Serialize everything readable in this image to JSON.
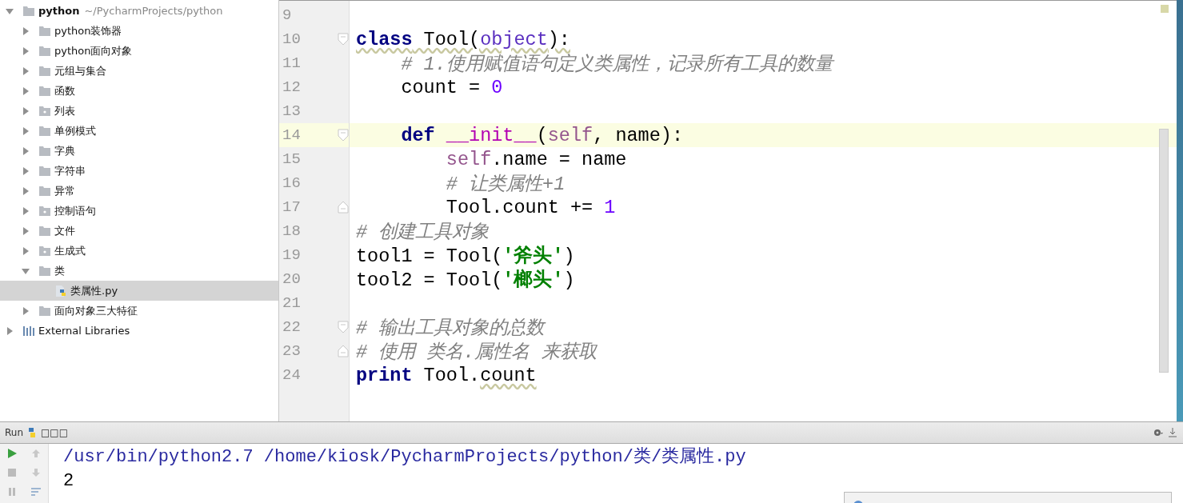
{
  "project_tree": [
    {
      "label": "python",
      "path": "~/PycharmProjects/python",
      "kind": "folder",
      "expanded": true,
      "selected": false,
      "children": [
        {
          "label": "python装饰器",
          "kind": "folder",
          "expanded": false,
          "selected": false
        },
        {
          "label": "python面向对象",
          "kind": "folder",
          "expanded": false,
          "selected": false
        },
        {
          "label": "元组与集合",
          "kind": "folder",
          "expanded": false,
          "selected": false
        },
        {
          "label": "函数",
          "kind": "folder",
          "expanded": false,
          "selected": false
        },
        {
          "label": "列表",
          "kind": "package",
          "expanded": false,
          "selected": false
        },
        {
          "label": "单例模式",
          "kind": "folder",
          "expanded": false,
          "selected": false
        },
        {
          "label": "字典",
          "kind": "folder",
          "expanded": false,
          "selected": false
        },
        {
          "label": "字符串",
          "kind": "folder",
          "expanded": false,
          "selected": false
        },
        {
          "label": "异常",
          "kind": "folder",
          "expanded": false,
          "selected": false
        },
        {
          "label": "控制语句",
          "kind": "package",
          "expanded": false,
          "selected": false
        },
        {
          "label": "文件",
          "kind": "folder",
          "expanded": false,
          "selected": false
        },
        {
          "label": "生成式",
          "kind": "package",
          "expanded": false,
          "selected": false
        },
        {
          "label": "类",
          "kind": "folder",
          "expanded": true,
          "selected": false,
          "children": [
            {
              "label": "类属性.py",
              "kind": "python-file",
              "selected": true
            }
          ]
        },
        {
          "label": "面向对象三大特征",
          "kind": "folder",
          "expanded": false,
          "selected": false
        }
      ]
    },
    {
      "label": "External Libraries",
      "kind": "library",
      "expanded": false,
      "selected": false
    }
  ],
  "editor": {
    "lines": [
      {
        "number": "9",
        "current": false,
        "fold_start": false,
        "fold_end": false
      },
      {
        "number": "10",
        "current": false,
        "fold_start": true,
        "fold_end": false,
        "tokens": [
          {
            "kind": "keyword",
            "text": "class",
            "underlined": true
          },
          {
            "kind": "plain",
            "text": " Tool(",
            "underlined": true
          },
          {
            "kind": "builtin",
            "text": "object",
            "underlined": true
          },
          {
            "kind": "plain",
            "text": "):",
            "underlined": true
          }
        ]
      },
      {
        "number": "11",
        "current": false,
        "fold_start": false,
        "fold_end": false,
        "tokens": [
          {
            "kind": "comment",
            "text": "    # 1.使用赋值语句定义类属性，记录所有工具的数量"
          }
        ]
      },
      {
        "number": "12",
        "current": false,
        "fold_start": false,
        "fold_end": false,
        "tokens": [
          {
            "kind": "plain",
            "text": "    count = "
          },
          {
            "kind": "number",
            "text": "0"
          }
        ]
      },
      {
        "number": "13",
        "current": false,
        "fold_start": false,
        "fold_end": false
      },
      {
        "number": "14",
        "current": true,
        "fold_start": true,
        "fold_end": false,
        "tokens": [
          {
            "kind": "keyword",
            "text": "    def"
          },
          {
            "kind": "magic",
            "text": " __init__"
          },
          {
            "kind": "plain",
            "text": "("
          },
          {
            "kind": "self",
            "text": "self"
          },
          {
            "kind": "plain",
            "text": ", name):"
          }
        ]
      },
      {
        "number": "15",
        "current": false,
        "fold_start": false,
        "fold_end": false,
        "tokens": [
          {
            "kind": "self",
            "text": "        self"
          },
          {
            "kind": "plain",
            "text": ".name = name"
          }
        ]
      },
      {
        "number": "16",
        "current": false,
        "fold_start": false,
        "fold_end": false,
        "tokens": [
          {
            "kind": "comment",
            "text": "        # 让类属性+1"
          }
        ]
      },
      {
        "number": "17",
        "current": false,
        "fold_start": false,
        "fold_end": true,
        "tokens": [
          {
            "kind": "plain",
            "text": "        Tool.count += "
          },
          {
            "kind": "number",
            "text": "1"
          }
        ]
      },
      {
        "number": "18",
        "current": false,
        "fold_start": false,
        "fold_end": false,
        "tokens": [
          {
            "kind": "comment",
            "text": "# 创建工具对象"
          }
        ]
      },
      {
        "number": "19",
        "current": false,
        "fold_start": false,
        "fold_end": false,
        "tokens": [
          {
            "kind": "plain",
            "text": "tool1 = Tool("
          },
          {
            "kind": "string",
            "text": "'斧头'"
          },
          {
            "kind": "plain",
            "text": ")"
          }
        ]
      },
      {
        "number": "20",
        "current": false,
        "fold_start": false,
        "fold_end": false,
        "tokens": [
          {
            "kind": "plain",
            "text": "tool2 = Tool("
          },
          {
            "kind": "string",
            "text": "'榔头'"
          },
          {
            "kind": "plain",
            "text": ")"
          }
        ]
      },
      {
        "number": "21",
        "current": false,
        "fold_start": false,
        "fold_end": false
      },
      {
        "number": "22",
        "current": false,
        "fold_start": true,
        "fold_end": false,
        "tokens": [
          {
            "kind": "comment",
            "text": "# 输出工具对象的总数"
          }
        ]
      },
      {
        "number": "23",
        "current": false,
        "fold_start": false,
        "fold_end": true,
        "tokens": [
          {
            "kind": "comment",
            "text": "# 使用 类名.属性名 来获取"
          }
        ]
      },
      {
        "number": "24",
        "current": false,
        "fold_start": false,
        "fold_end": false,
        "tokens": [
          {
            "kind": "keyword",
            "text": "print"
          },
          {
            "kind": "plain",
            "text": " Tool."
          },
          {
            "kind": "plain",
            "text": "count",
            "underlined": true
          }
        ]
      }
    ]
  },
  "run_panel": {
    "title": "Run",
    "tab_label": "□□□",
    "output": [
      {
        "kind": "command",
        "text": "/usr/bin/python2.7 /home/kiosk/PycharmProjects/python/类/类属性.py"
      },
      {
        "kind": "stdout",
        "text": "2"
      }
    ]
  }
}
